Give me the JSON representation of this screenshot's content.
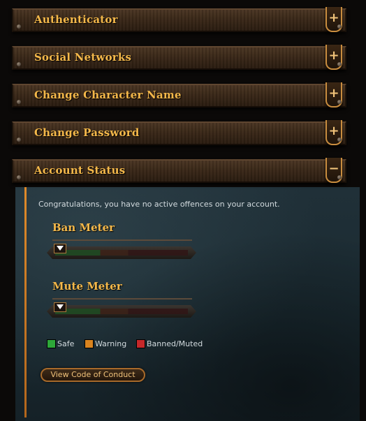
{
  "sections": [
    {
      "title": "Authenticator",
      "state": "collapsed",
      "toggle": "+"
    },
    {
      "title": "Social Networks",
      "state": "collapsed",
      "toggle": "+"
    },
    {
      "title": "Change Character Name",
      "state": "collapsed",
      "toggle": "+"
    },
    {
      "title": "Change Password",
      "state": "collapsed",
      "toggle": "+"
    },
    {
      "title": "Account Status",
      "state": "expanded",
      "toggle": "−"
    }
  ],
  "account_status": {
    "message": "Congratulations, you have no active offences on your account.",
    "ban_meter": {
      "label": "Ban Meter",
      "level": 0
    },
    "mute_meter": {
      "label": "Mute Meter",
      "level": 0
    },
    "legend": [
      {
        "label": "Safe",
        "color": "#2ea83a"
      },
      {
        "label": "Warning",
        "color": "#d9841f"
      },
      {
        "label": "Banned/Muted",
        "color": "#c6282a"
      }
    ],
    "code_of_conduct_button": "View Code of Conduct"
  },
  "colors": {
    "title": "#f4b84a",
    "accent": "#c98d3f",
    "panel": "#1c2c33"
  }
}
